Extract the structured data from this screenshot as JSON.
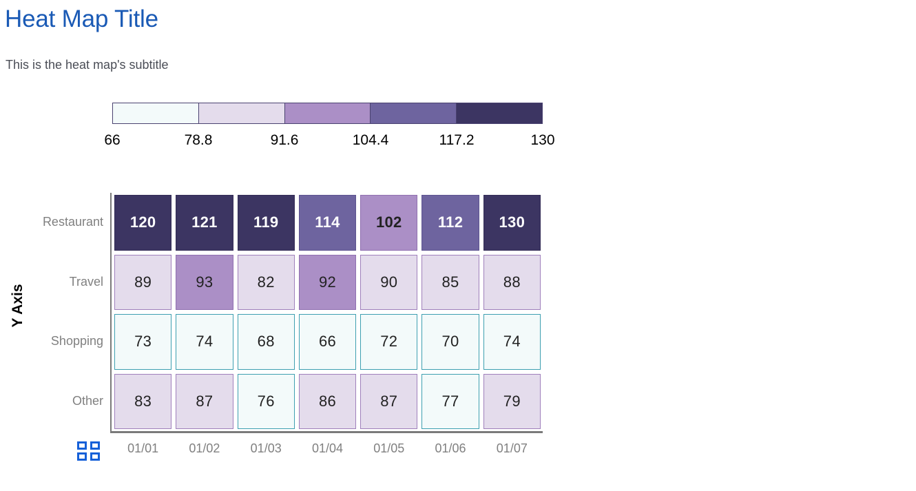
{
  "header": {
    "title": "Heat Map Title",
    "subtitle": "This is the heat map's subtitle"
  },
  "colors": {
    "title": "#1a5ab5",
    "subtitle": "#4a4d56",
    "axis_label": "#808080",
    "axis_line": "#7a7a7a",
    "icon_blue": "#1660d8",
    "band_1_fill": "#f3fafa",
    "band_1_border": "#3d9fb0",
    "band_2_fill": "#e4dcec",
    "band_2_border": "#9f7fbb",
    "band_3_fill": "#ab8fc6",
    "band_3_border": "#8f6fb0",
    "band_4_fill": "#6e649f",
    "band_4_border": "#5c5390",
    "band_5_fill": "#3c3562",
    "band_5_border": "#332c56",
    "legend_border": "#4a4270"
  },
  "legend": {
    "name": "color-scale-legend",
    "ticks": [
      "66",
      "78.8",
      "91.6",
      "104.4",
      "117.2",
      "130"
    ],
    "bands": [
      {
        "label": "66 - 78.8",
        "fill": "#f3fafa"
      },
      {
        "label": "78.8 - 91.6",
        "fill": "#e4dcec"
      },
      {
        "label": "91.6 - 104.4",
        "fill": "#ab8fc6"
      },
      {
        "label": "104.4 - 117.2",
        "fill": "#6e649f"
      },
      {
        "label": "117.2 - 130",
        "fill": "#3c3562"
      }
    ]
  },
  "axes": {
    "y_title": "Y Axis",
    "x_labels": [
      "01/01",
      "01/02",
      "01/03",
      "01/04",
      "01/05",
      "01/06",
      "01/07"
    ],
    "y_labels": [
      "Restaurant",
      "Travel",
      "Shopping",
      "Other"
    ]
  },
  "toolbar": {
    "grid_icon_label": "grid-view-toggle"
  },
  "chart_data": {
    "type": "heatmap",
    "title": "Heat Map Title",
    "subtitle": "This is the heat map's subtitle",
    "xlabel": "",
    "ylabel": "Y Axis",
    "x": [
      "01/01",
      "01/02",
      "01/03",
      "01/04",
      "01/05",
      "01/06",
      "01/07"
    ],
    "y": [
      "Restaurant",
      "Travel",
      "Shopping",
      "Other"
    ],
    "zmin": 66,
    "zmax": 130,
    "colorbar_ticks": [
      66,
      78.8,
      91.6,
      104.4,
      117.2,
      130
    ],
    "colorscale": [
      "#f3fafa",
      "#e4dcec",
      "#ab8fc6",
      "#6e649f",
      "#3c3562"
    ],
    "legend_position": "top",
    "grid": false,
    "values": [
      [
        120,
        121,
        119,
        114,
        102,
        112,
        130
      ],
      [
        89,
        93,
        82,
        92,
        90,
        85,
        88
      ],
      [
        73,
        74,
        68,
        66,
        72,
        70,
        74
      ],
      [
        83,
        87,
        76,
        86,
        87,
        77,
        79
      ]
    ],
    "cells": [
      [
        {
          "v": 120,
          "fill": "#3c3562",
          "border": "#332c56",
          "text": "#ffffff",
          "bold": true
        },
        {
          "v": 121,
          "fill": "#3c3562",
          "border": "#332c56",
          "text": "#ffffff",
          "bold": true
        },
        {
          "v": 119,
          "fill": "#3c3562",
          "border": "#332c56",
          "text": "#ffffff",
          "bold": true
        },
        {
          "v": 114,
          "fill": "#6e649f",
          "border": "#5c5390",
          "text": "#ffffff",
          "bold": true
        },
        {
          "v": 102,
          "fill": "#ab8fc6",
          "border": "#8f6fb0",
          "text": "#222222",
          "bold": true
        },
        {
          "v": 112,
          "fill": "#6e649f",
          "border": "#5c5390",
          "text": "#ffffff",
          "bold": true
        },
        {
          "v": 130,
          "fill": "#3c3562",
          "border": "#332c56",
          "text": "#ffffff",
          "bold": true
        }
      ],
      [
        {
          "v": 89,
          "fill": "#e4dcec",
          "border": "#9f7fbb",
          "text": "#222222",
          "bold": false
        },
        {
          "v": 93,
          "fill": "#ab8fc6",
          "border": "#8f6fb0",
          "text": "#222222",
          "bold": false
        },
        {
          "v": 82,
          "fill": "#e4dcec",
          "border": "#9f7fbb",
          "text": "#222222",
          "bold": false
        },
        {
          "v": 92,
          "fill": "#ab8fc6",
          "border": "#8f6fb0",
          "text": "#222222",
          "bold": false
        },
        {
          "v": 90,
          "fill": "#e4dcec",
          "border": "#9f7fbb",
          "text": "#222222",
          "bold": false
        },
        {
          "v": 85,
          "fill": "#e4dcec",
          "border": "#9f7fbb",
          "text": "#222222",
          "bold": false
        },
        {
          "v": 88,
          "fill": "#e4dcec",
          "border": "#9f7fbb",
          "text": "#222222",
          "bold": false
        }
      ],
      [
        {
          "v": 73,
          "fill": "#f3fafa",
          "border": "#3d9fb0",
          "text": "#222222",
          "bold": false
        },
        {
          "v": 74,
          "fill": "#f3fafa",
          "border": "#3d9fb0",
          "text": "#222222",
          "bold": false
        },
        {
          "v": 68,
          "fill": "#f3fafa",
          "border": "#3d9fb0",
          "text": "#222222",
          "bold": false
        },
        {
          "v": 66,
          "fill": "#f3fafa",
          "border": "#3d9fb0",
          "text": "#222222",
          "bold": false
        },
        {
          "v": 72,
          "fill": "#f3fafa",
          "border": "#3d9fb0",
          "text": "#222222",
          "bold": false
        },
        {
          "v": 70,
          "fill": "#f3fafa",
          "border": "#3d9fb0",
          "text": "#222222",
          "bold": false
        },
        {
          "v": 74,
          "fill": "#f3fafa",
          "border": "#3d9fb0",
          "text": "#222222",
          "bold": false
        }
      ],
      [
        {
          "v": 83,
          "fill": "#e4dcec",
          "border": "#9f7fbb",
          "text": "#222222",
          "bold": false
        },
        {
          "v": 87,
          "fill": "#e4dcec",
          "border": "#9f7fbb",
          "text": "#222222",
          "bold": false
        },
        {
          "v": 76,
          "fill": "#f3fafa",
          "border": "#3d9fb0",
          "text": "#222222",
          "bold": false
        },
        {
          "v": 86,
          "fill": "#e4dcec",
          "border": "#9f7fbb",
          "text": "#222222",
          "bold": false
        },
        {
          "v": 87,
          "fill": "#e4dcec",
          "border": "#9f7fbb",
          "text": "#222222",
          "bold": false
        },
        {
          "v": 77,
          "fill": "#f3fafa",
          "border": "#3d9fb0",
          "text": "#222222",
          "bold": false
        },
        {
          "v": 79,
          "fill": "#e4dcec",
          "border": "#9f7fbb",
          "text": "#222222",
          "bold": false
        }
      ]
    ]
  }
}
